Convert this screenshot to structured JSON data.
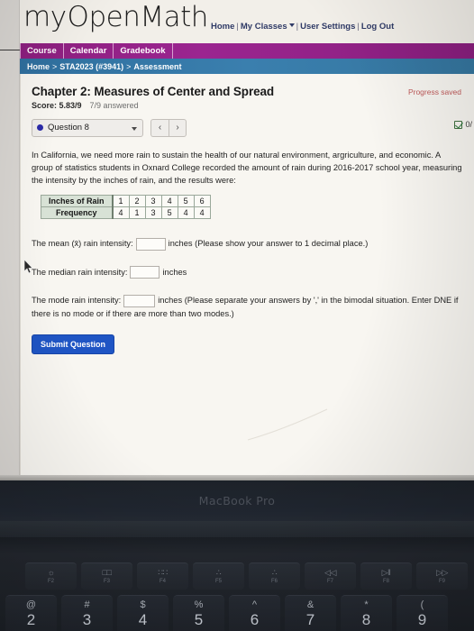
{
  "site": {
    "logo_part1": "my",
    "logo_part2": "Open",
    "logo_part3": "Math",
    "nav": [
      {
        "label": "Home",
        "has_caret": false
      },
      {
        "label": "My Classes",
        "has_caret": true
      },
      {
        "label": "User Settings",
        "has_caret": false
      },
      {
        "label": "Log Out",
        "has_caret": false
      }
    ],
    "tabs": [
      "Course",
      "Calendar",
      "Gradebook"
    ],
    "breadcrumb": {
      "item1": "Home",
      "sep1": ">",
      "item2": "STA2023 (#3941)",
      "sep2": ">",
      "item3": "Assessment"
    }
  },
  "assessment": {
    "title": "Chapter 2: Measures of Center and Spread",
    "score_label": "Score: 5.83/9",
    "answered_label": "7/9 answered",
    "progress_saved": "Progress saved",
    "question_selector": "Question 8",
    "prev_label": "‹",
    "next_label": "›",
    "mark_label": "0/",
    "dot_color": "#2a2aa8"
  },
  "question": {
    "prompt": "In California, we need more rain to sustain the health of our natural environment, argriculture, and economic. A group of statistics students in Oxnard College recorded the amount of rain during 2016-2017 school year, measuring the intensity by the inches of rain, and the results were:",
    "table": {
      "row1_header": "Inches of Rain",
      "row1_values": [
        "1",
        "2",
        "3",
        "4",
        "5",
        "6"
      ],
      "row2_header": "Frequency",
      "row2_values": [
        "4",
        "1",
        "3",
        "5",
        "4",
        "4"
      ]
    },
    "mean_label": "The mean (x̄) rain intensity:",
    "mean_value": "",
    "mean_unit": "inches",
    "mean_hint": "(Please show your answer to 1 decimal place.)",
    "median_label": "The median rain intensity:",
    "median_value": "",
    "median_unit": "inches",
    "mode_label": "The mode rain intensity:",
    "mode_value": "",
    "mode_unit": "inches",
    "mode_hint": "(Please separate your answers by ',' in the bimodal situation. Enter DNE if there is no mode or if there are more than two modes.)",
    "submit_label": "Submit Question"
  },
  "laptop": {
    "brand": "MacBook Pro",
    "function_keys": [
      {
        "glyph": "☼",
        "label": "F2"
      },
      {
        "glyph": "□□",
        "label": "F3"
      },
      {
        "glyph": "∷∷",
        "label": "F4"
      },
      {
        "glyph": "∴",
        "label": "F5"
      },
      {
        "glyph": "∴",
        "label": "F6"
      },
      {
        "glyph": "◁◁",
        "label": "F7"
      },
      {
        "glyph": "▷‖",
        "label": "F8"
      },
      {
        "glyph": "▷▷",
        "label": "F9"
      }
    ],
    "number_keys": [
      {
        "sym": "@",
        "num": "2"
      },
      {
        "sym": "#",
        "num": "3"
      },
      {
        "sym": "$",
        "num": "4"
      },
      {
        "sym": "%",
        "num": "5"
      },
      {
        "sym": "^",
        "num": "6"
      },
      {
        "sym": "&",
        "num": "7"
      },
      {
        "sym": "*",
        "num": "8"
      },
      {
        "sym": "(",
        "num": "9"
      }
    ]
  }
}
